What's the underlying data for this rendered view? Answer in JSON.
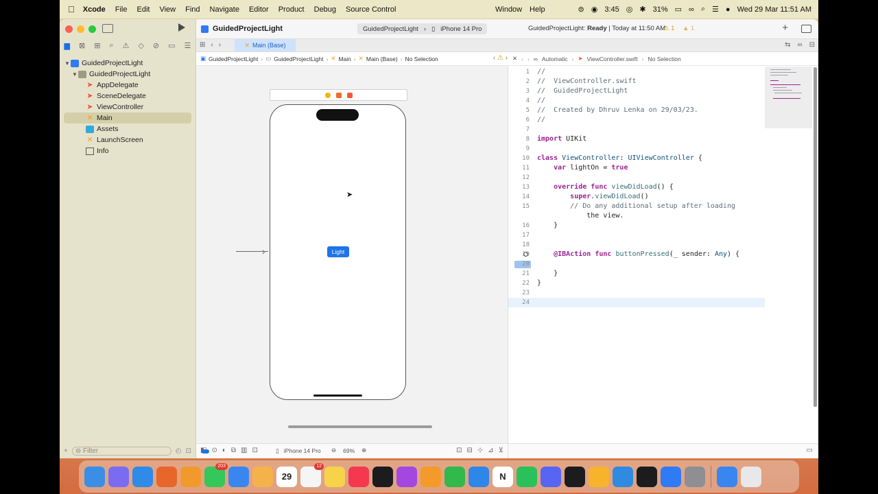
{
  "menubar": {
    "app_name": "Xcode",
    "items": [
      "File",
      "Edit",
      "View",
      "Find",
      "Navigate",
      "Editor",
      "Product",
      "Debug",
      "Source Control",
      "Window",
      "Help"
    ],
    "timer": "3:45",
    "battery": "31%",
    "datetime": "Wed 29 Mar  11:51 AM"
  },
  "toolbar": {
    "project": "GuidedProjectLight",
    "scheme": "GuidedProjectLight",
    "device": "iPhone 14 Pro",
    "status_project": "GuidedProjectLight:",
    "status_state": "Ready",
    "status_time": "Today at 11:50 AM",
    "warnings": "1",
    "issues": "1"
  },
  "navigator": {
    "items": [
      {
        "label": "GuidedProjectLight",
        "kind": "project"
      },
      {
        "label": "GuidedProjectLight",
        "kind": "folder"
      },
      {
        "label": "AppDelegate",
        "kind": "swift"
      },
      {
        "label": "SceneDelegate",
        "kind": "swift"
      },
      {
        "label": "ViewController",
        "kind": "swift"
      },
      {
        "label": "Main",
        "kind": "storyboard",
        "selected": true
      },
      {
        "label": "Assets",
        "kind": "assets"
      },
      {
        "label": "LaunchScreen",
        "kind": "storyboard"
      },
      {
        "label": "Info",
        "kind": "plist"
      }
    ],
    "filter_placeholder": "Filter"
  },
  "editor_tab": {
    "label": "Main (Base)"
  },
  "ib": {
    "jump": [
      "GuidedProjectLight",
      "GuidedProjectLight",
      "Main",
      "Main (Base)",
      "No Selection"
    ],
    "button_label": "Light",
    "device": "iPhone 14 Pro",
    "zoom": "69%"
  },
  "code": {
    "jump": [
      "Automatic",
      "ViewController.swift",
      "No Selection"
    ],
    "lines": [
      {
        "n": "1",
        "t": "//"
      },
      {
        "n": "2",
        "t": "//  ViewController.swift"
      },
      {
        "n": "3",
        "t": "//  GuidedProjectLight"
      },
      {
        "n": "4",
        "t": "//"
      },
      {
        "n": "5",
        "t": "//  Created by Dhruv Lenka on 29/03/23."
      },
      {
        "n": "6",
        "t": "//"
      },
      {
        "n": "7",
        "t": ""
      },
      {
        "n": "8",
        "t": "import UIKit"
      },
      {
        "n": "9",
        "t": ""
      },
      {
        "n": "10",
        "t": "class ViewController: UIViewController {"
      },
      {
        "n": "11",
        "t": "    var lightOn = true"
      },
      {
        "n": "12",
        "t": ""
      },
      {
        "n": "13",
        "t": "    override func viewDidLoad() {"
      },
      {
        "n": "14",
        "t": "        super.viewDidLoad()"
      },
      {
        "n": "15",
        "t": "        // Do any additional setup after loading"
      },
      {
        "n": "",
        "t": "            the view."
      },
      {
        "n": "16",
        "t": "    }"
      },
      {
        "n": "17",
        "t": ""
      },
      {
        "n": "18",
        "t": ""
      },
      {
        "n": "19",
        "t": "    @IBAction func buttonPressed(_ sender: Any) {"
      },
      {
        "n": "20",
        "t": ""
      },
      {
        "n": "21",
        "t": "    }"
      },
      {
        "n": "22",
        "t": "}"
      },
      {
        "n": "23",
        "t": ""
      },
      {
        "n": "24",
        "t": ""
      }
    ]
  },
  "dock": {
    "apps": [
      {
        "name": "finder-icon",
        "color": "#3a8ee6",
        "label": ""
      },
      {
        "name": "launchpad-icon",
        "color": "#7a6cf0",
        "label": ""
      },
      {
        "name": "safari-icon",
        "color": "#2f8ae8",
        "label": ""
      },
      {
        "name": "firefox-icon",
        "color": "#e8662a",
        "label": ""
      },
      {
        "name": "books-icon",
        "color": "#f2992e",
        "label": ""
      },
      {
        "name": "messages-icon",
        "color": "#34c759",
        "label": "",
        "badge": "203"
      },
      {
        "name": "mail-icon",
        "color": "#3a86f0",
        "label": ""
      },
      {
        "name": "photos-icon",
        "color": "#f5b24a",
        "label": ""
      },
      {
        "name": "calendar-icon",
        "color": "#ffffff",
        "label": "29"
      },
      {
        "name": "reminders-icon",
        "color": "#f5f5f5",
        "label": "",
        "badge": "12"
      },
      {
        "name": "notes-icon",
        "color": "#f7d34a",
        "label": ""
      },
      {
        "name": "music-icon",
        "color": "#f5384f",
        "label": ""
      },
      {
        "name": "tv-icon",
        "color": "#1c1c1e",
        "label": ""
      },
      {
        "name": "podcasts-icon",
        "color": "#a347e0",
        "label": ""
      },
      {
        "name": "pages-icon",
        "color": "#f39a2b",
        "label": ""
      },
      {
        "name": "numbers-icon",
        "color": "#31b94b",
        "label": ""
      },
      {
        "name": "keynote-icon",
        "color": "#2e86e8",
        "label": ""
      },
      {
        "name": "notion-icon",
        "color": "#ffffff",
        "label": "N"
      },
      {
        "name": "whatsapp-icon",
        "color": "#2bc15a",
        "label": ""
      },
      {
        "name": "discord-icon",
        "color": "#5865f2",
        "label": ""
      },
      {
        "name": "terminal-icon",
        "color": "#1c1c1e",
        "label": ""
      },
      {
        "name": "sketch-icon",
        "color": "#f7b32b",
        "label": ""
      },
      {
        "name": "vscode-icon",
        "color": "#2f8ae0",
        "label": ""
      },
      {
        "name": "intellij-icon",
        "color": "#1c1c1e",
        "label": ""
      },
      {
        "name": "xcode-icon",
        "color": "#2f7bf6",
        "label": ""
      },
      {
        "name": "system-settings-icon",
        "color": "#8e8e93",
        "label": ""
      }
    ],
    "after_sep": [
      {
        "name": "simulator-icon",
        "color": "#3a86f0",
        "label": ""
      },
      {
        "name": "trash-icon",
        "color": "#e8e8e8",
        "label": ""
      }
    ]
  }
}
